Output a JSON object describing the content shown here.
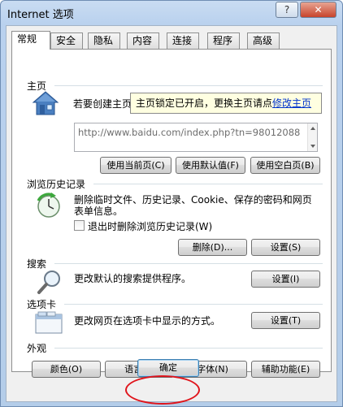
{
  "window": {
    "title": "Internet 选项",
    "help_label": "?",
    "close_label": "✕"
  },
  "tabs": [
    {
      "label": "常规",
      "active": true
    },
    {
      "label": "安全"
    },
    {
      "label": "隐私"
    },
    {
      "label": "内容"
    },
    {
      "label": "连接"
    },
    {
      "label": "程序"
    },
    {
      "label": "高级"
    }
  ],
  "homepage": {
    "section_title": "主页",
    "description_prefix": "若要创建主页",
    "url_value": "http://www.baidu.com/index.php?tn=98012088",
    "tooltip_text": "主页锁定已开启，更换主页请点",
    "tooltip_link": "修改主页",
    "buttons": {
      "use_current": "使用当前页(C)",
      "use_default": "使用默认值(F)",
      "use_blank": "使用空白页(B)"
    }
  },
  "history": {
    "section_title": "浏览历史记录",
    "description_line1": "删除临时文件、历史记录、Cookie、保存的密码和网页",
    "description_line2": "表单信息。",
    "checkbox_label": "退出时删除浏览历史记录(W)",
    "checkbox_checked": false,
    "buttons": {
      "delete": "删除(D)...",
      "settings": "设置(S)"
    }
  },
  "search": {
    "section_title": "搜索",
    "description": "更改默认的搜索提供程序。",
    "settings_button": "设置(I)"
  },
  "tabs_section": {
    "section_title": "选项卡",
    "description": "更改网页在选项卡中显示的方式。",
    "settings_button": "设置(T)"
  },
  "appearance": {
    "section_title": "外观",
    "buttons": {
      "colors": "颜色(O)",
      "languages": "语言(L)",
      "fonts": "字体(N)",
      "accessibility": "辅助功能(E)"
    }
  },
  "footer": {
    "ok_label": "确定"
  },
  "colors": {
    "annotation_circle": "#e0141b",
    "link": "#0033cc",
    "tooltip_bg": "#ffffe1"
  }
}
